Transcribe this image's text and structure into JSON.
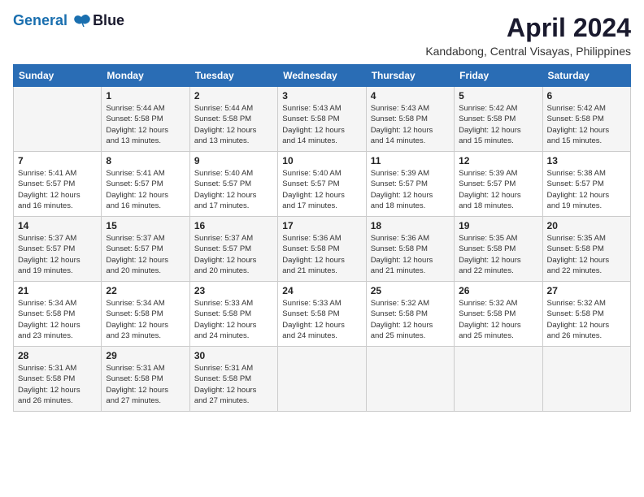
{
  "logo": {
    "line1": "General",
    "line2": "Blue"
  },
  "title": "April 2024",
  "location": "Kandabong, Central Visayas, Philippines",
  "header": {
    "days": [
      "Sunday",
      "Monday",
      "Tuesday",
      "Wednesday",
      "Thursday",
      "Friday",
      "Saturday"
    ]
  },
  "weeks": [
    [
      {
        "day": "",
        "info": ""
      },
      {
        "day": "1",
        "info": "Sunrise: 5:44 AM\nSunset: 5:58 PM\nDaylight: 12 hours\nand 13 minutes."
      },
      {
        "day": "2",
        "info": "Sunrise: 5:44 AM\nSunset: 5:58 PM\nDaylight: 12 hours\nand 13 minutes."
      },
      {
        "day": "3",
        "info": "Sunrise: 5:43 AM\nSunset: 5:58 PM\nDaylight: 12 hours\nand 14 minutes."
      },
      {
        "day": "4",
        "info": "Sunrise: 5:43 AM\nSunset: 5:58 PM\nDaylight: 12 hours\nand 14 minutes."
      },
      {
        "day": "5",
        "info": "Sunrise: 5:42 AM\nSunset: 5:58 PM\nDaylight: 12 hours\nand 15 minutes."
      },
      {
        "day": "6",
        "info": "Sunrise: 5:42 AM\nSunset: 5:58 PM\nDaylight: 12 hours\nand 15 minutes."
      }
    ],
    [
      {
        "day": "7",
        "info": "Sunrise: 5:41 AM\nSunset: 5:57 PM\nDaylight: 12 hours\nand 16 minutes."
      },
      {
        "day": "8",
        "info": "Sunrise: 5:41 AM\nSunset: 5:57 PM\nDaylight: 12 hours\nand 16 minutes."
      },
      {
        "day": "9",
        "info": "Sunrise: 5:40 AM\nSunset: 5:57 PM\nDaylight: 12 hours\nand 17 minutes."
      },
      {
        "day": "10",
        "info": "Sunrise: 5:40 AM\nSunset: 5:57 PM\nDaylight: 12 hours\nand 17 minutes."
      },
      {
        "day": "11",
        "info": "Sunrise: 5:39 AM\nSunset: 5:57 PM\nDaylight: 12 hours\nand 18 minutes."
      },
      {
        "day": "12",
        "info": "Sunrise: 5:39 AM\nSunset: 5:57 PM\nDaylight: 12 hours\nand 18 minutes."
      },
      {
        "day": "13",
        "info": "Sunrise: 5:38 AM\nSunset: 5:57 PM\nDaylight: 12 hours\nand 19 minutes."
      }
    ],
    [
      {
        "day": "14",
        "info": "Sunrise: 5:37 AM\nSunset: 5:57 PM\nDaylight: 12 hours\nand 19 minutes."
      },
      {
        "day": "15",
        "info": "Sunrise: 5:37 AM\nSunset: 5:57 PM\nDaylight: 12 hours\nand 20 minutes."
      },
      {
        "day": "16",
        "info": "Sunrise: 5:37 AM\nSunset: 5:57 PM\nDaylight: 12 hours\nand 20 minutes."
      },
      {
        "day": "17",
        "info": "Sunrise: 5:36 AM\nSunset: 5:58 PM\nDaylight: 12 hours\nand 21 minutes."
      },
      {
        "day": "18",
        "info": "Sunrise: 5:36 AM\nSunset: 5:58 PM\nDaylight: 12 hours\nand 21 minutes."
      },
      {
        "day": "19",
        "info": "Sunrise: 5:35 AM\nSunset: 5:58 PM\nDaylight: 12 hours\nand 22 minutes."
      },
      {
        "day": "20",
        "info": "Sunrise: 5:35 AM\nSunset: 5:58 PM\nDaylight: 12 hours\nand 22 minutes."
      }
    ],
    [
      {
        "day": "21",
        "info": "Sunrise: 5:34 AM\nSunset: 5:58 PM\nDaylight: 12 hours\nand 23 minutes."
      },
      {
        "day": "22",
        "info": "Sunrise: 5:34 AM\nSunset: 5:58 PM\nDaylight: 12 hours\nand 23 minutes."
      },
      {
        "day": "23",
        "info": "Sunrise: 5:33 AM\nSunset: 5:58 PM\nDaylight: 12 hours\nand 24 minutes."
      },
      {
        "day": "24",
        "info": "Sunrise: 5:33 AM\nSunset: 5:58 PM\nDaylight: 12 hours\nand 24 minutes."
      },
      {
        "day": "25",
        "info": "Sunrise: 5:32 AM\nSunset: 5:58 PM\nDaylight: 12 hours\nand 25 minutes."
      },
      {
        "day": "26",
        "info": "Sunrise: 5:32 AM\nSunset: 5:58 PM\nDaylight: 12 hours\nand 25 minutes."
      },
      {
        "day": "27",
        "info": "Sunrise: 5:32 AM\nSunset: 5:58 PM\nDaylight: 12 hours\nand 26 minutes."
      }
    ],
    [
      {
        "day": "28",
        "info": "Sunrise: 5:31 AM\nSunset: 5:58 PM\nDaylight: 12 hours\nand 26 minutes."
      },
      {
        "day": "29",
        "info": "Sunrise: 5:31 AM\nSunset: 5:58 PM\nDaylight: 12 hours\nand 27 minutes."
      },
      {
        "day": "30",
        "info": "Sunrise: 5:31 AM\nSunset: 5:58 PM\nDaylight: 12 hours\nand 27 minutes."
      },
      {
        "day": "",
        "info": ""
      },
      {
        "day": "",
        "info": ""
      },
      {
        "day": "",
        "info": ""
      },
      {
        "day": "",
        "info": ""
      }
    ]
  ]
}
